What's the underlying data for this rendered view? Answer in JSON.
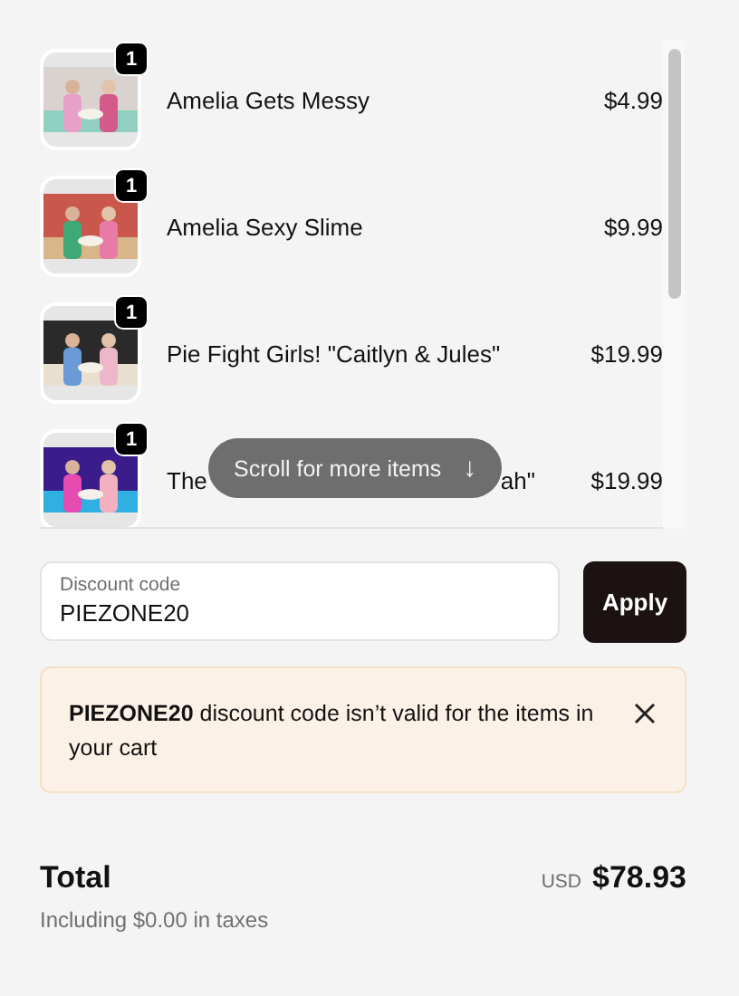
{
  "cart_items": [
    {
      "quantity": "1",
      "title_parts": [
        "Amelia Gets Messy"
      ],
      "price": "$4.99",
      "thumbnail": {
        "kind": "picture"
      }
    },
    {
      "quantity": "1",
      "title_parts": [
        "Amelia Sexy Slime"
      ],
      "price": "$9.99",
      "thumbnail": {
        "kind": "picture"
      }
    },
    {
      "quantity": "1",
      "title_parts": [
        "Pie Fight Girls! \"Caitlyn & Jules\""
      ],
      "price": "$19.99",
      "thumbnail": {
        "kind": "picture"
      }
    },
    {
      "quantity": "1",
      "title_parts": [
        "The",
        "ah\""
      ],
      "price": "$19.99",
      "thumbnail": {
        "kind": "picture"
      }
    }
  ],
  "scroll_hint": {
    "label": "Scroll for more items",
    "icon": "↓"
  },
  "discount": {
    "label": "Discount code",
    "value": "PIEZONE20",
    "button": "Apply"
  },
  "alert": {
    "message": "**PIEZONE20** discount code isn’t valid for the items in your cart",
    "dismissible": true
  },
  "total": {
    "label": "Total",
    "currency": "USD",
    "amount": "$78.93",
    "taxes_note": "Including $0.00 in taxes"
  }
}
